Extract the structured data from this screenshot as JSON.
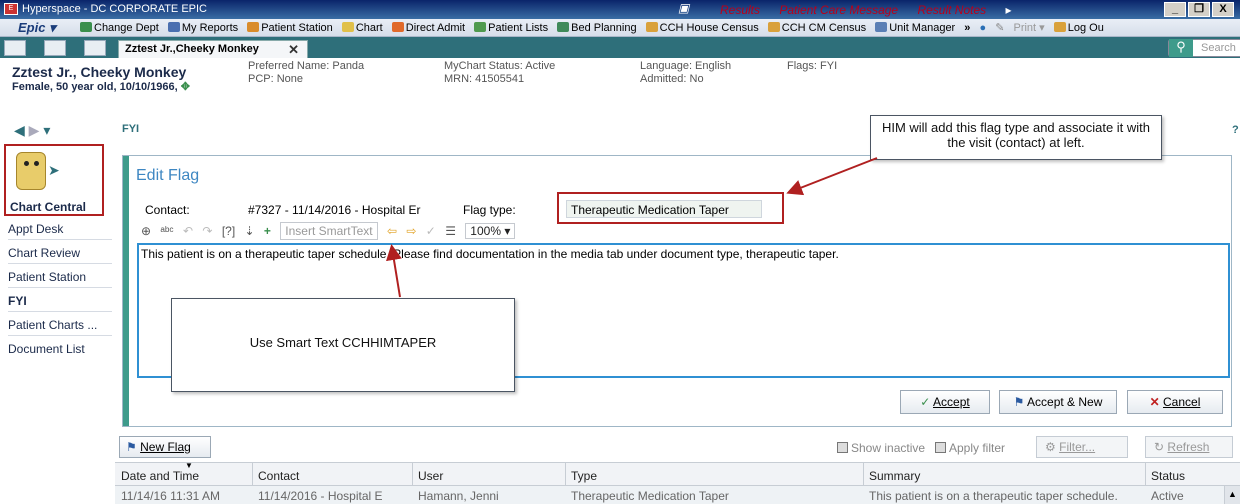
{
  "window": {
    "title": "Hyperspace - DC CORPORATE EPIC",
    "links": [
      "Results",
      "Patient Care Message",
      "Result Notes"
    ],
    "controls": [
      "_",
      "❐",
      "X"
    ]
  },
  "toolbar": {
    "brand": "Epic ▾",
    "items": [
      "Change Dept",
      "My Reports",
      "Patient Station",
      "Chart",
      "Direct Admit",
      "Patient Lists",
      "Bed Planning",
      "CCH House Census",
      "CCH CM Census",
      "Unit Manager"
    ],
    "more": "»",
    "print": "Print ▾",
    "logout": "Log Ou"
  },
  "tabs": {
    "patient_tab": "Zztest Jr.,Cheeky Monkey",
    "close": "✕",
    "search_placeholder": "Search"
  },
  "patient": {
    "name": "Zztest Jr., Cheeky Monkey",
    "info": "Female, 50 year old, 10/10/1966,",
    "preferred_name": "Preferred Name: Panda",
    "pcp": "PCP: None",
    "mychart": "MyChart Status: Active",
    "mrn": "MRN: 41505541",
    "language": "Language: English",
    "admitted": "Admitted: No",
    "flags": "Flags: FYI"
  },
  "nav": {
    "back": "◀",
    "forward": "▶",
    "down": "▾"
  },
  "section_label": "FYI",
  "help": "?",
  "sidebar": {
    "primary": "Chart Central",
    "items": [
      "Appt Desk",
      "Chart Review",
      "Patient Station",
      "FYI",
      "Patient Charts ...",
      "Document List"
    ]
  },
  "edit_flag": {
    "title": "Edit Flag",
    "contact_label": "Contact:",
    "contact_value": "#7327 - 11/14/2016 - Hospital Er",
    "flag_type_label": "Flag type:",
    "flag_type_value": "Therapeutic Medication Taper",
    "insert_smarttext": "Insert SmartText",
    "zoom": "100% ▾",
    "note_text": "This patient is on a therapeutic taper schedule.  Please find documentation in the media tab under document type, therapeutic taper.",
    "accept": "Accept",
    "accept_new": "Accept & New",
    "cancel": "Cancel"
  },
  "callouts": {
    "him": "HIM will add this flag type and associate it with the visit (contact) at left.",
    "smarttext": "Use Smart Text CCHHIMTAPER"
  },
  "list": {
    "new_flag": "New Flag",
    "show_inactive": "Show inactive",
    "apply_filter": "Apply filter",
    "filter": "Filter...",
    "refresh": "Refresh",
    "columns": [
      "Date and Time",
      "Contact",
      "User",
      "Type",
      "Summary",
      "Status"
    ],
    "rows": [
      [
        "11/14/16 11:31 AM",
        "11/14/2016 - Hospital E",
        "Hamann, Jenni",
        "Therapeutic Medication Taper",
        "This patient is on a therapeutic taper schedule.",
        "Active"
      ]
    ]
  },
  "colors": {
    "teal": "#2e6f7a",
    "accent_red": "#b02020",
    "link_blue": "#3e87c2",
    "editor_border": "#2f90d3"
  }
}
